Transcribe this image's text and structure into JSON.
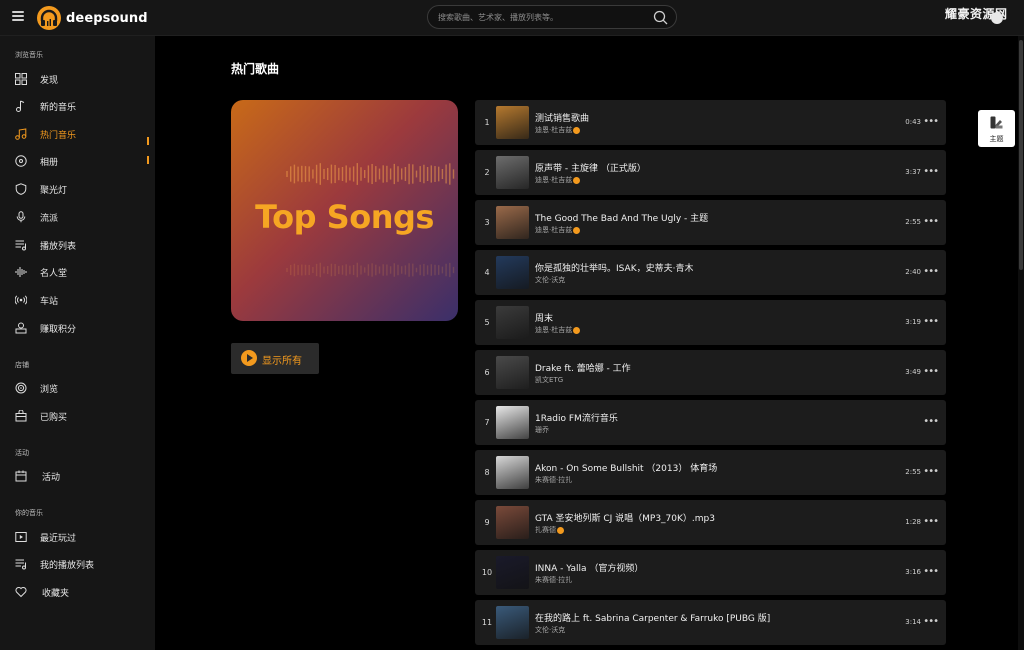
{
  "app": {
    "logo_text": "deepsound",
    "watermark": "耀豪资源网"
  },
  "search": {
    "placeholder": "搜索歌曲、艺术家、播放列表等。"
  },
  "sidebar": {
    "sections": [
      {
        "title": "浏览音乐"
      },
      {
        "title": "店铺"
      },
      {
        "title": "活动"
      },
      {
        "title": "你的音乐"
      }
    ],
    "items": [
      {
        "label": "发现",
        "icon": "grid-icon"
      },
      {
        "label": "新的音乐",
        "icon": "music-note-icon"
      },
      {
        "label": "热门音乐",
        "icon": "music-notes-icon",
        "active": true
      },
      {
        "label": "相册",
        "icon": "disc-icon"
      },
      {
        "label": "聚光灯",
        "icon": "shield-icon"
      },
      {
        "label": "流派",
        "icon": "microphone-icon"
      },
      {
        "label": "播放列表",
        "icon": "playlist-icon"
      },
      {
        "label": "名人堂",
        "icon": "waveform-icon"
      },
      {
        "label": "车站",
        "icon": "radio-icon"
      },
      {
        "label": "赚取积分",
        "icon": "points-icon"
      },
      {
        "label": "浏览",
        "icon": "target-icon"
      },
      {
        "label": "已购买",
        "icon": "bag-icon"
      },
      {
        "label": "活动",
        "icon": "calendar-icon"
      },
      {
        "label": "最近玩过",
        "icon": "play-box-icon"
      },
      {
        "label": "我的播放列表",
        "icon": "playlist-icon"
      },
      {
        "label": "收藏夹",
        "icon": "heart-icon"
      }
    ]
  },
  "main": {
    "title": "热门歌曲",
    "cover_text": "Top Songs",
    "show_all_label": "显示所有"
  },
  "tracks": [
    {
      "num": "1",
      "title": "测试销售歌曲",
      "artist": "迪恩·杜吉兹",
      "verified": true,
      "duration": "0:43",
      "thumb_color": "#b5792f"
    },
    {
      "num": "2",
      "title": "原声带 - 主旋律 （正式版）",
      "artist": "迪恩·杜吉兹",
      "verified": true,
      "duration": "3:37",
      "thumb_color": "#6d6d6d"
    },
    {
      "num": "3",
      "title": "The Good The Bad And The Ugly - 主题",
      "artist": "迪恩·杜吉兹",
      "verified": true,
      "duration": "2:55",
      "thumb_color": "#9a6a4a"
    },
    {
      "num": "4",
      "title": "你是孤独的壮举吗。ISAK，史蒂夫·青木",
      "artist": "文伦·沃克",
      "verified": false,
      "duration": "2:40",
      "thumb_color": "#233a5c"
    },
    {
      "num": "5",
      "title": "周末",
      "artist": "迪恩·杜吉兹",
      "verified": true,
      "duration": "3:19",
      "thumb_color": "#3b3b3b"
    },
    {
      "num": "6",
      "title": "Drake ft. 蕾哈娜 - 工作",
      "artist": "凯文ETG",
      "verified": false,
      "duration": "3:49",
      "thumb_color": "#4a4a4a"
    },
    {
      "num": "7",
      "title": "1Radio FM流行音乐",
      "artist": "珊乔",
      "verified": false,
      "duration": "",
      "thumb_color": "#e8e8e8"
    },
    {
      "num": "8",
      "title": "Akon - On Some Bullshit （2013） 体育场",
      "artist": "朱赛德·拉扎",
      "verified": false,
      "duration": "2:55",
      "thumb_color": "#d8d8d8"
    },
    {
      "num": "9",
      "title": "GTA 圣安地列斯 CJ 说唱（MP3_70K）.mp3",
      "artist": "扎赛德",
      "verified": true,
      "duration": "1:28",
      "thumb_color": "#7a4a3a"
    },
    {
      "num": "10",
      "title": "INNA - Yalla （官方视频）",
      "artist": "朱赛德·拉扎",
      "verified": false,
      "duration": "3:16",
      "thumb_color": "#1a1a2a"
    },
    {
      "num": "11",
      "title": "在我的路上 ft. Sabrina Carpenter & Farruko [PUBG 版]",
      "artist": "文伦·沃克",
      "verified": false,
      "duration": "3:14",
      "thumb_color": "#3a5a7a"
    }
  ],
  "theme_button": {
    "label": "主题"
  },
  "colors": {
    "accent": "#f39a1e",
    "background": "#000000",
    "panel": "#161616",
    "row": "#1c1c1c"
  }
}
